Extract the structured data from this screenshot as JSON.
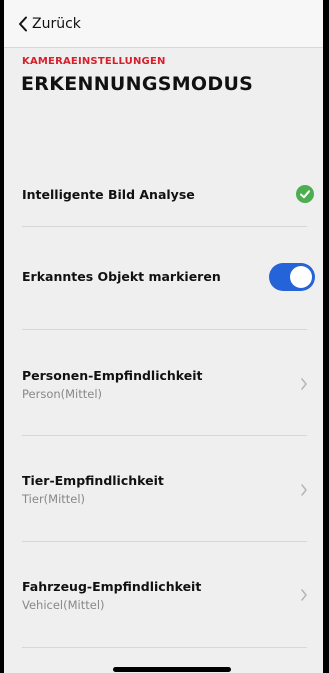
{
  "nav": {
    "back_label": "Zurück"
  },
  "header": {
    "eyebrow": "KAMERAEINSTELLUNGEN",
    "title": "ERKENNUNGSMODUS"
  },
  "settings": {
    "smart_analysis": {
      "label": "Intelligente Bild Analyse",
      "enabled": true,
      "icon": "check-circle-icon",
      "color": "#4cae4f"
    },
    "mark_object": {
      "label": "Erkanntes Objekt markieren",
      "toggle_on": true,
      "color": "#2563d8"
    },
    "person": {
      "label": "Personen-Empfindlichkeit",
      "value": "Person(Mittel)"
    },
    "animal": {
      "label": "Tier-Empfindlichkeit",
      "value": "Tier(Mittel)"
    },
    "vehicle": {
      "label": "Fahrzeug-Empfindlichkeit",
      "value": "Vehicel(Mittel)"
    }
  },
  "colors": {
    "accent_red": "#d6202b",
    "background": "#efefef"
  }
}
